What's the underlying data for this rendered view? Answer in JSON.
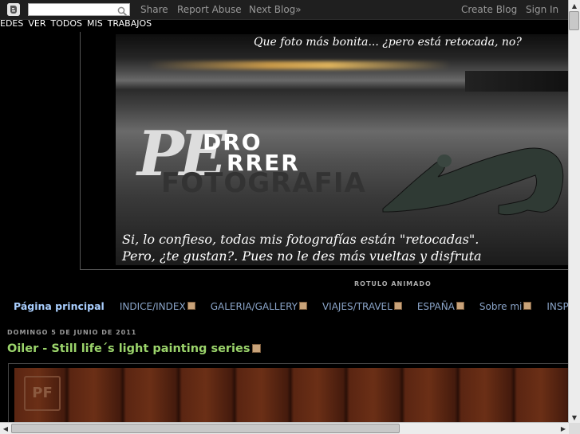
{
  "navbar": {
    "search_placeholder": "",
    "links": [
      "Share",
      "Report Abuse",
      "Next Blog»"
    ],
    "right_links": [
      "Create Blog",
      "Sign In"
    ]
  },
  "top_menu": [
    "EDES",
    "VER",
    "TODOS",
    "MIS",
    "TRABAJOS"
  ],
  "header": {
    "tagline_top": "Que foto más bonita... ¿pero está retocada, no?",
    "logo_line1": "DRO",
    "logo_line2": "RRER",
    "logo_p": "PE",
    "logo_f": "FOTOGRAFIA",
    "tagline_bottom_1": "Si, lo confieso, todas mis fotografías están \"retocadas\".",
    "tagline_bottom_2": "Pero, ¿te gustan?. Pues no le des más vueltas y disfruta"
  },
  "rotulo": "ROTULO ANIMADO",
  "pages": [
    {
      "label": "Página principal",
      "icon": false
    },
    {
      "label": "INDICE/INDEX",
      "icon": true
    },
    {
      "label": "GALERIA/GALLERY",
      "icon": true
    },
    {
      "label": "VIAJES/TRAVEL",
      "icon": true
    },
    {
      "label": "ESPAÑA",
      "icon": true
    },
    {
      "label": "Sobre mi",
      "icon": true
    },
    {
      "label": "INSPIRA",
      "icon": false
    }
  ],
  "post": {
    "date": "DOMINGO 5 DE JUNIO DE 2011",
    "title": "Oiler - Still life´s light painting series",
    "image_mark": "PF"
  },
  "colors": {
    "background": "#000000",
    "post_title": "#9bd46b",
    "page_link": "#8aa4c8"
  }
}
